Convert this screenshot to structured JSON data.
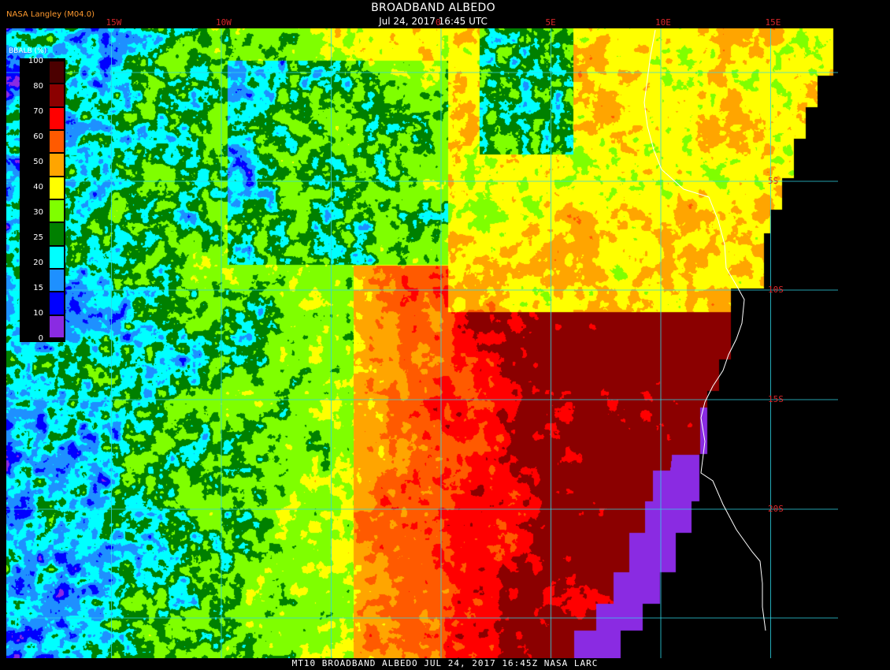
{
  "header": {
    "provider": "NASA Langley (M04.0)",
    "title": "BROADBAND ALBEDO",
    "subtitle": "Jul 24, 2017 16:45 UTC"
  },
  "footer": {
    "text": "MT10  BROADBAND ALBEDO  JUL 24, 2017 16:45Z  NASA LARC"
  },
  "grid": {
    "lon_labels": [
      {
        "text": "15W",
        "lon": -15
      },
      {
        "text": "10W",
        "lon": -10
      },
      {
        "text": "0",
        "lon": 0
      },
      {
        "text": "5E",
        "lon": 5
      },
      {
        "text": "10E",
        "lon": 10
      },
      {
        "text": "15E",
        "lon": 15
      }
    ],
    "lat_labels": [
      {
        "text": "5S",
        "lat": -5
      },
      {
        "text": "10S",
        "lat": -10
      },
      {
        "text": "15S",
        "lat": -15
      },
      {
        "text": "20S",
        "lat": -20
      }
    ]
  },
  "legend": {
    "title": "BBALB (%)",
    "ticks": [
      "100",
      "80",
      "70",
      "60",
      "50",
      "40",
      "30",
      "25",
      "20",
      "15",
      "10",
      "0"
    ],
    "colors": [
      "#4b0000",
      "#8b0000",
      "#ff0000",
      "#ff5a00",
      "#ffa500",
      "#ffff00",
      "#7fff00",
      "#008000",
      "#00ffff",
      "#1e90ff",
      "#0000ff",
      "#8a2be2"
    ]
  },
  "colors": {
    "grid": "#2fd6e6",
    "coast": "#ffffff",
    "no_data": "#000000",
    "labels": "#d8262a"
  }
}
